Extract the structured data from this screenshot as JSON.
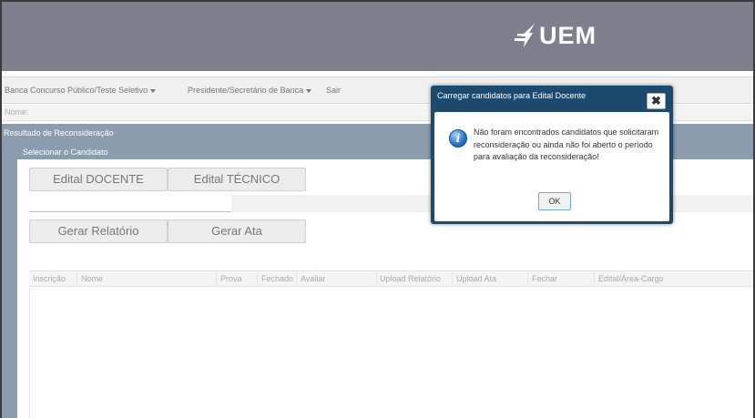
{
  "header": {
    "logo_text": "UEM",
    "colors": {
      "header_bg": "#7d7f8c",
      "panel_bg": "#8a9cae",
      "dialog_bg": "#1c4a6e"
    }
  },
  "menu": {
    "items": [
      {
        "label": "Banca Concurso Público/Teste Seletivo",
        "has_dropdown": true
      },
      {
        "label": "Presidente/Secretário de Banca",
        "has_dropdown": true
      },
      {
        "label": "Sair",
        "has_dropdown": false
      }
    ]
  },
  "nome_label": "Nome:",
  "result_panel": {
    "title": "Resultado de Reconsideração",
    "select_panel": {
      "title": "Selecionar o Candidato",
      "buttons": {
        "edital_docente": "Edital DOCENTE",
        "edital_tecnico": "Edital TÉCNICO",
        "gerar_relatorio": "Gerar Relatório",
        "gerar_ata": "Gerar Ata"
      },
      "grid_columns": [
        "Inscrição",
        "Nome",
        "Prova",
        "Fechado",
        "Avaliar",
        "Upload Relatório",
        "Upload Ata",
        "Fechar",
        "Edital/Área-Cargo"
      ]
    }
  },
  "dialog": {
    "title": "Carregar candidatos para Edital Docente",
    "close_glyph": "✖",
    "icon": "info-icon",
    "message": "Não foram encontrados candidatos que solicitaram reconsideração ou ainda não foi aberto o período para avaliação da reconsideração!",
    "ok_label": "OK"
  }
}
